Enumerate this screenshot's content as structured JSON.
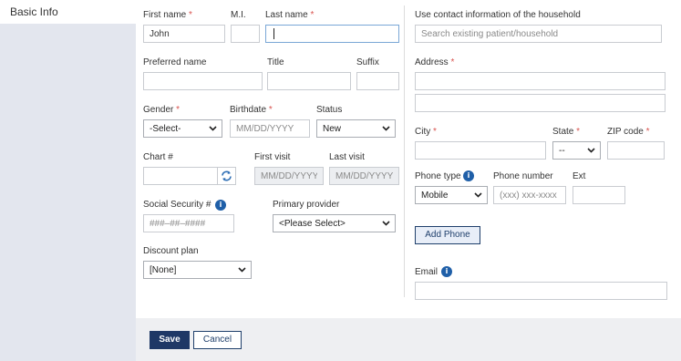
{
  "sidebar": {
    "tab_label": "Basic Info"
  },
  "form": {
    "first_name": {
      "label": "First name",
      "value": "John"
    },
    "mi": {
      "label": "M.I."
    },
    "last_name": {
      "label": "Last name",
      "value": ""
    },
    "preferred_name": {
      "label": "Preferred name"
    },
    "title": {
      "label": "Title"
    },
    "suffix": {
      "label": "Suffix"
    },
    "gender": {
      "label": "Gender",
      "selected": "-Select-"
    },
    "birthdate": {
      "label": "Birthdate",
      "placeholder": "MM/DD/YYYY"
    },
    "status": {
      "label": "Status",
      "selected": "New"
    },
    "chart": {
      "label": "Chart #"
    },
    "first_visit": {
      "label": "First visit",
      "placeholder": "MM/DD/YYYY"
    },
    "last_visit": {
      "label": "Last visit",
      "placeholder": "MM/DD/YYYY"
    },
    "ssn": {
      "label": "Social Security #",
      "placeholder": "###–##–####"
    },
    "primary_provider": {
      "label": "Primary provider",
      "selected": "<Please Select>"
    },
    "discount_plan": {
      "label": "Discount plan",
      "selected": "[None]"
    }
  },
  "contact": {
    "household": {
      "label": "Use contact information of the household",
      "placeholder": "Search existing patient/household"
    },
    "address": {
      "label": "Address"
    },
    "city": {
      "label": "City"
    },
    "state": {
      "label": "State",
      "selected": "--"
    },
    "zip": {
      "label": "ZIP code"
    },
    "phone_type": {
      "label": "Phone type",
      "selected": "Mobile"
    },
    "phone_number": {
      "label": "Phone number",
      "placeholder": "(xxx) xxx-xxxx"
    },
    "ext": {
      "label": "Ext"
    },
    "add_phone_label": "Add Phone",
    "email": {
      "label": "Email"
    }
  },
  "footer": {
    "save_label": "Save",
    "cancel_label": "Cancel"
  },
  "required_mark": "*"
}
